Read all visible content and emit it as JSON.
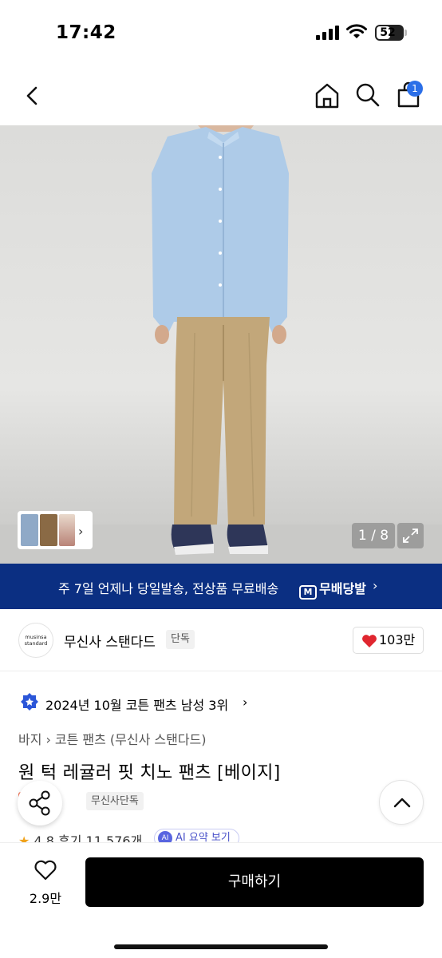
{
  "status_bar": {
    "time": "17:42",
    "battery": "52",
    "battery_level": 0.52
  },
  "nav": {
    "cart_count": "1"
  },
  "gallery": {
    "pager": "1 / 8"
  },
  "banner": {
    "text": "주 7일 언제나 당일발송, 전상품 무료배송",
    "logo_mark": "M",
    "logo_text": "무배당발"
  },
  "brand": {
    "logo_line1": "musinsa",
    "logo_line2": "standard",
    "name": "무신사 스탠다드",
    "tag": "단독",
    "likes": "103만"
  },
  "ranking": {
    "text": "2024년 10월 코튼 팬츠 남성 3위"
  },
  "breadcrumb": {
    "level1": "바지",
    "level2": "코튼 팬츠 (무신사 스탠다드)"
  },
  "product": {
    "title": "원 턱 레귤러 핏 치노 팬츠 [베이지]",
    "tag_sale": "세일",
    "tag_exclusive": "무신사단독"
  },
  "rating": {
    "score": "4.8",
    "reviews": "후기 11,576개",
    "ai_mark": "AI",
    "ai_label": "AI 요약 보기"
  },
  "bottom": {
    "wish_count": "2.9만",
    "buy_label": "구매하기"
  },
  "colors": {
    "banner": "#0b2f82",
    "badge": "#2b6fe8",
    "sale": "#f37659",
    "heart": "#e0262f"
  }
}
